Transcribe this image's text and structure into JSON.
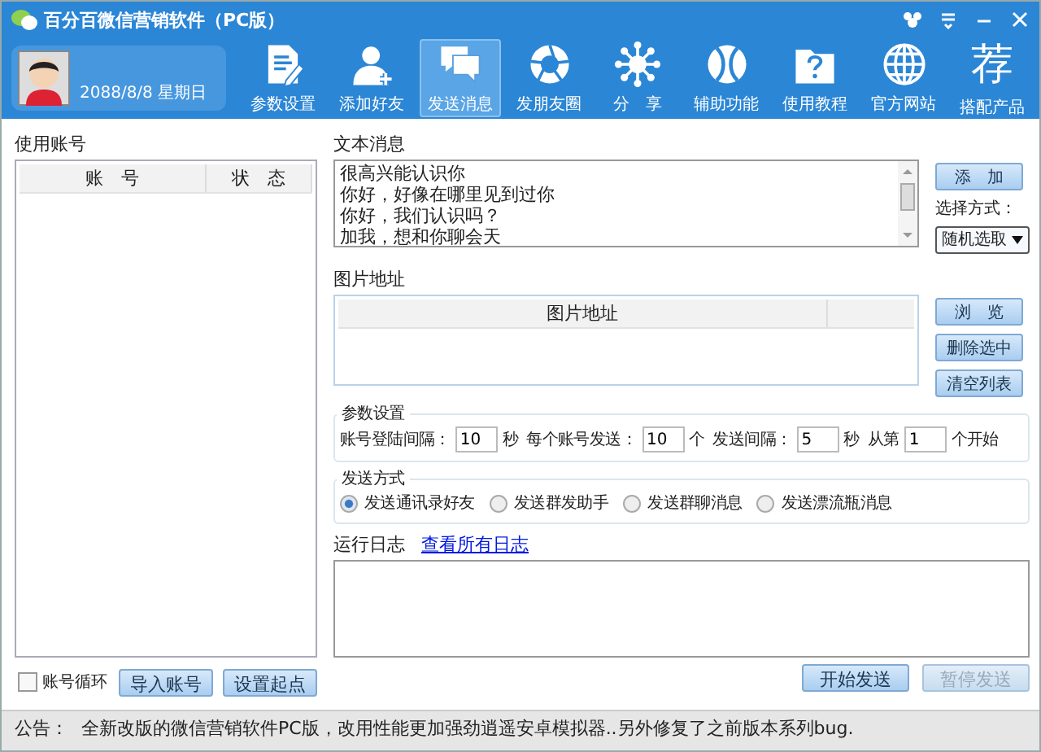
{
  "window": {
    "title": "百分百微信营销软件（PC版）"
  },
  "user": {
    "date": "2088/8/8 星期日"
  },
  "toolbar": [
    {
      "label": "参数设置",
      "kind": "document",
      "selected": false
    },
    {
      "label": "添加好友",
      "kind": "person",
      "selected": false
    },
    {
      "label": "发送消息",
      "kind": "chat",
      "selected": true
    },
    {
      "label": "发朋友圈",
      "kind": "aperture",
      "selected": false
    },
    {
      "label": "分　享",
      "kind": "share",
      "selected": false
    },
    {
      "label": "辅助功能",
      "kind": "ball",
      "selected": false
    },
    {
      "label": "使用教程",
      "kind": "folder",
      "selected": false
    },
    {
      "label": "官方网站",
      "kind": "globe",
      "selected": false
    },
    {
      "label": "搭配产品",
      "kind": "glyph",
      "glyph": "荐",
      "selected": false
    }
  ],
  "accounts": {
    "title": "使用账号",
    "columns": [
      "账　号",
      "状　态"
    ],
    "loop": {
      "label": "账号循环",
      "checked": false
    },
    "buttons": [
      "导入账号",
      "设置起点"
    ]
  },
  "message": {
    "title": "文本消息",
    "lines": [
      "很高兴能认识你",
      "你好，好像在哪里见到过你",
      "你好，我们认识吗？",
      "加我，想和你聊会天"
    ],
    "add_button": "添　加",
    "mode_label": "选择方式：",
    "mode": "随机选取"
  },
  "images": {
    "title": "图片地址",
    "columns": [
      "图片地址"
    ],
    "buttons": [
      "浏　览",
      "删除选中",
      "清空列表"
    ]
  },
  "params": {
    "title": "参数设置",
    "fields": [
      {
        "label": "账号登陆间隔：",
        "value": "10",
        "unit": "秒"
      },
      {
        "label": "每个账号发送：",
        "value": "10",
        "unit": "个"
      },
      {
        "label": "发送间隔：",
        "value": "5",
        "unit": "秒"
      },
      {
        "label": "从第",
        "value": "1",
        "unit": "个开始"
      }
    ]
  },
  "send_mode": {
    "title": "发送方式",
    "options": [
      {
        "label": "发送通讯录好友",
        "selected": true
      },
      {
        "label": "发送群发助手",
        "selected": false
      },
      {
        "label": "发送群聊消息",
        "selected": false
      },
      {
        "label": "发送漂流瓶消息",
        "selected": false
      }
    ]
  },
  "log": {
    "title": "运行日志",
    "link": "查看所有日志"
  },
  "actions": [
    {
      "label": "开始发送",
      "disabled": false
    },
    {
      "label": "暂停发送",
      "disabled": true
    }
  ],
  "notice": {
    "label": "公告：",
    "text": "全新改版的微信营销软件PC版，改用性能更加强劲逍遥安卓模拟器..另外修复了之前版本系列bug."
  }
}
